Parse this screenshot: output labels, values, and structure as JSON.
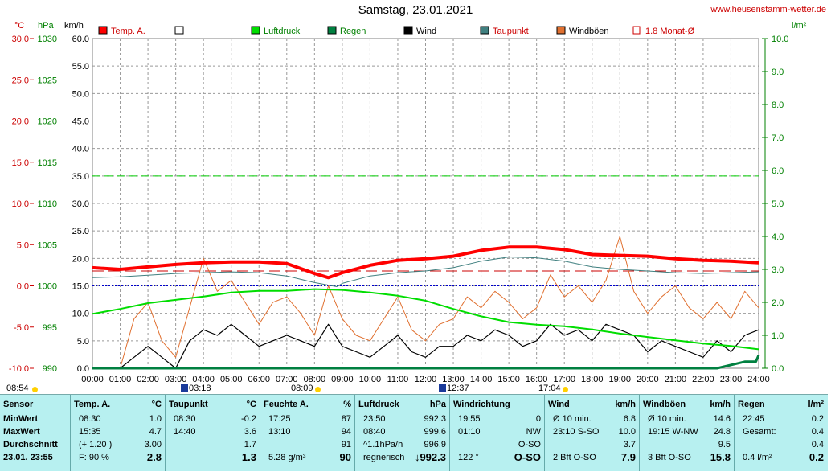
{
  "header": {
    "title": "Samstag, 23.01.2021",
    "site": "www.heusenstamm-wetter.de",
    "unit_temp": "°C",
    "unit_press": "hPa",
    "unit_wind": "km/h",
    "unit_rain": "l/m²"
  },
  "legend": [
    {
      "label": "Temp. A.",
      "color": "#ff0000"
    },
    {
      "label": "",
      "color": "#ffffff"
    },
    {
      "label": "Luftdruck",
      "color": "#00dd00"
    },
    {
      "label": "Regen",
      "color": "#008040"
    },
    {
      "label": "Wind",
      "color": "#000000"
    },
    {
      "label": "Taupunkt",
      "color": "#408080"
    },
    {
      "label": "Windböen",
      "color": "#e07030"
    },
    {
      "label": "1.8 Monat-Ø",
      "color": "#cc0000"
    }
  ],
  "chart_data": {
    "type": "line",
    "x_ticks": [
      "00:00",
      "01:00",
      "02:00",
      "03:00",
      "04:00",
      "05:00",
      "06:00",
      "07:00",
      "08:00",
      "09:00",
      "10:00",
      "11:00",
      "12:00",
      "13:00",
      "14:00",
      "15:00",
      "16:00",
      "17:00",
      "18:00",
      "19:00",
      "20:00",
      "21:00",
      "22:00",
      "23:00",
      "24:00"
    ],
    "y_temp_ticks": [
      "30.0",
      "25.0",
      "20.0",
      "15.0",
      "10.0",
      "5.0",
      "0.0",
      "-5.0",
      "-10.0"
    ],
    "y_press_ticks": [
      "1030",
      "1025",
      "1020",
      "1015",
      "1010",
      "1005",
      "1000",
      "995",
      "990"
    ],
    "y_wind_ticks": [
      "60.0",
      "55.0",
      "50.0",
      "45.0",
      "40.0",
      "35.0",
      "30.0",
      "25.0",
      "20.0",
      "15.0",
      "10.0",
      "5.0",
      "0.0"
    ],
    "y_rain_ticks": [
      "10.0",
      "9.0",
      "8.0",
      "7.0",
      "6.0",
      "5.0",
      "4.0",
      "3.0",
      "2.0",
      "1.0",
      "0.0"
    ],
    "ylim_temp": [
      -10,
      30
    ],
    "ylim_press": [
      990,
      1030
    ],
    "ylim_wind": [
      0,
      60
    ],
    "ylim_rain": [
      0,
      10
    ],
    "xlim_hours": [
      0,
      24
    ],
    "reference_lines": {
      "monthly_avg_temp": 1.8,
      "zero_temp": 0.0,
      "wind_35": 35.0
    },
    "series": [
      {
        "name": "Temp. A.",
        "x": [
          0,
          1,
          2,
          3,
          4,
          5,
          6,
          7,
          8,
          8.5,
          9,
          10,
          11,
          12,
          13,
          14,
          15,
          16,
          17,
          18,
          19,
          20,
          21,
          22,
          23,
          24
        ],
        "y": [
          2.2,
          2.0,
          2.3,
          2.6,
          2.8,
          2.9,
          2.9,
          2.7,
          1.5,
          1.0,
          1.6,
          2.5,
          3.1,
          3.3,
          3.6,
          4.3,
          4.7,
          4.7,
          4.4,
          3.8,
          3.7,
          3.6,
          3.3,
          3.1,
          3.0,
          2.8
        ]
      },
      {
        "name": "Taupunkt",
        "x": [
          0,
          1,
          2,
          3,
          4,
          5,
          6,
          7,
          8,
          8.8,
          9,
          10,
          11,
          12,
          13,
          14,
          15,
          16,
          17,
          18,
          19,
          20,
          21,
          22,
          23,
          24
        ],
        "y": [
          1.0,
          1.1,
          1.3,
          1.5,
          1.6,
          1.7,
          1.6,
          1.2,
          0.4,
          -0.1,
          0.3,
          1.2,
          1.6,
          1.8,
          2.2,
          3.0,
          3.5,
          3.4,
          3.0,
          2.3,
          2.0,
          1.8,
          1.6,
          1.5,
          1.6,
          1.7
        ]
      },
      {
        "name": "Luftdruck",
        "x": [
          0,
          1,
          2,
          3,
          4,
          5,
          6,
          7,
          8,
          9,
          10,
          11,
          12,
          13,
          14,
          15,
          16,
          17,
          18,
          19,
          20,
          21,
          22,
          23,
          24
        ],
        "y": [
          996.6,
          997.2,
          997.9,
          998.3,
          998.7,
          999.2,
          999.4,
          999.4,
          999.6,
          999.5,
          999.2,
          998.8,
          998.2,
          997.2,
          996.3,
          995.6,
          995.3,
          995.1,
          994.7,
          994.2,
          993.8,
          993.4,
          993.0,
          992.7,
          992.3
        ]
      },
      {
        "name": "Wind",
        "x": [
          0,
          1,
          1.5,
          2,
          2.5,
          3,
          3.5,
          4,
          4.5,
          5,
          5.5,
          6,
          6.5,
          7,
          7.5,
          8,
          8.5,
          9,
          9.5,
          10,
          10.5,
          11,
          11.5,
          12,
          12.5,
          13,
          13.5,
          14,
          14.5,
          15,
          15.5,
          16,
          16.5,
          17,
          17.5,
          18,
          18.5,
          19,
          19.5,
          20,
          20.5,
          21,
          21.5,
          22,
          22.5,
          23,
          23.5,
          24
        ],
        "y": [
          0,
          0,
          2,
          4,
          2,
          0,
          5,
          7,
          6,
          8,
          6,
          4,
          5,
          6,
          5,
          4,
          8,
          4,
          3,
          2,
          4,
          6,
          3,
          2,
          4,
          4,
          6,
          5,
          7,
          6,
          4,
          5,
          8,
          6,
          7,
          5,
          8,
          7,
          6,
          3,
          5,
          4,
          3,
          2,
          5,
          3,
          6,
          7
        ]
      },
      {
        "name": "Windböen",
        "x": [
          0,
          1,
          1.5,
          2,
          2.5,
          3,
          3.5,
          4,
          4.5,
          5,
          5.5,
          6,
          6.5,
          7,
          7.5,
          8,
          8.5,
          9,
          9.5,
          10,
          10.5,
          11,
          11.5,
          12,
          12.5,
          13,
          13.5,
          14,
          14.5,
          15,
          15.5,
          16,
          16.5,
          17,
          17.5,
          18,
          18.5,
          19,
          19.5,
          20,
          20.5,
          21,
          21.5,
          22,
          22.5,
          23,
          23.5,
          24
        ],
        "y": [
          0,
          0,
          9,
          12,
          5,
          2,
          11,
          20,
          14,
          16,
          12,
          8,
          12,
          13,
          10,
          6,
          15,
          9,
          6,
          5,
          9,
          13,
          7,
          5,
          8,
          9,
          13,
          11,
          14,
          12,
          9,
          11,
          17,
          13,
          15,
          12,
          16,
          24,
          14,
          10,
          13,
          15,
          11,
          9,
          12,
          9,
          14,
          11
        ]
      },
      {
        "name": "Regen",
        "x": [
          0,
          21,
          22.5,
          23.5,
          23.9,
          24
        ],
        "y": [
          0,
          0,
          0,
          0.2,
          0.2,
          0.4
        ]
      }
    ]
  },
  "markers": {
    "sunrise_left": "08:54",
    "moon1": "03:18",
    "sun1": "08:09",
    "moon2": "12:37",
    "sun2": "17:04"
  },
  "table": {
    "cols": [
      {
        "head": "Sensor",
        "head_unit": "",
        "rows": [
          [
            "MinWert",
            ""
          ],
          [
            "MaxWert",
            ""
          ],
          [
            "Durchschnitt",
            ""
          ],
          [
            "23.01. 23:55",
            ""
          ]
        ]
      },
      {
        "head": "Temp. A.",
        "head_unit": "°C",
        "rows": [
          [
            "08:30",
            "1.0"
          ],
          [
            "15:35",
            "4.7"
          ],
          [
            "(+ 1.20 )",
            "3.00"
          ],
          [
            "F: 90 %",
            "2.8"
          ]
        ]
      },
      {
        "head": "Taupunkt",
        "head_unit": "°C",
        "rows": [
          [
            "08:30",
            "-0.2"
          ],
          [
            "14:40",
            "3.6"
          ],
          [
            "",
            "1.7"
          ],
          [
            "",
            "1.3"
          ]
        ]
      },
      {
        "head": "Feuchte A.",
        "head_unit": "%",
        "rows": [
          [
            "17:25",
            "87"
          ],
          [
            "13:10",
            "94"
          ],
          [
            "",
            "91"
          ],
          [
            "5.28 g/m³",
            "90"
          ]
        ]
      },
      {
        "head": "Luftdruck",
        "head_unit": "hPa",
        "rows": [
          [
            "23:50",
            "992.3"
          ],
          [
            "08:40",
            "999.6"
          ],
          [
            "^1.1hPa/h",
            "996.9"
          ],
          [
            "regnerisch",
            "↓992.3"
          ]
        ]
      },
      {
        "head": "Windrichtung",
        "head_unit": "",
        "rows": [
          [
            "19:55",
            "0"
          ],
          [
            "01:10",
            "NW"
          ],
          [
            "",
            "O-SO"
          ],
          [
            "122 °",
            "O-SO"
          ]
        ]
      },
      {
        "head": "Wind",
        "head_unit": "km/h",
        "rows": [
          [
            "Ø 10 min.",
            "6.8"
          ],
          [
            "23:10   S-SO",
            "10.0"
          ],
          [
            "",
            "3.7"
          ],
          [
            "2 Bft O-SO",
            "7.9"
          ]
        ]
      },
      {
        "head": "Windböen",
        "head_unit": "km/h",
        "rows": [
          [
            "Ø 10 min.",
            "14.6"
          ],
          [
            "19:15   W-NW",
            "24.8"
          ],
          [
            "",
            "9.5"
          ],
          [
            "3 Bft O-SO",
            "15.8"
          ]
        ]
      },
      {
        "head": "Regen",
        "head_unit": "l/m²",
        "rows": [
          [
            "22:45",
            "0.2"
          ],
          [
            "Gesamt:",
            "0.4"
          ],
          [
            "",
            "0.4"
          ],
          [
            "0.4 l/m²",
            "0.2"
          ]
        ]
      }
    ]
  }
}
